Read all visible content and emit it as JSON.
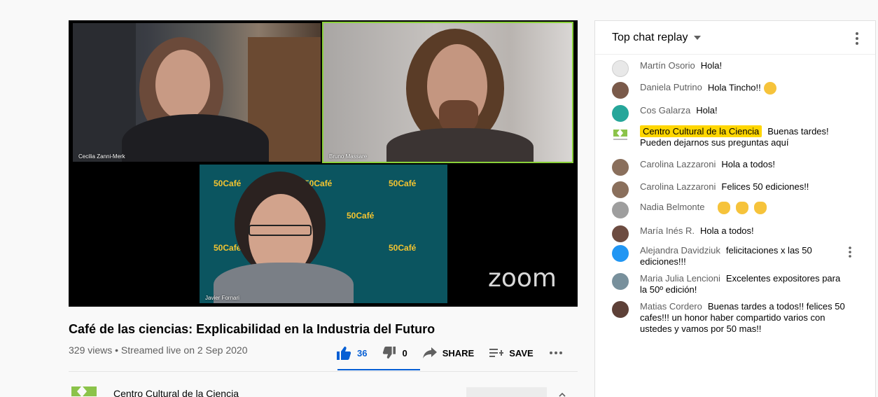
{
  "video": {
    "participants": [
      {
        "name": "Cecilia Zanni-Merk"
      },
      {
        "name": "Bruno Massare"
      },
      {
        "name": "Javier Fornari"
      }
    ],
    "brand_mark": "50Café",
    "zoom_logo": "zoom"
  },
  "video_info": {
    "title": "Café de las ciencias: Explicabilidad en la Industria del Futuro",
    "meta": "329 views • Streamed live on 2 Sep 2020"
  },
  "actions": {
    "like_count": "36",
    "dislike_count": "0",
    "share_label": "SHARE",
    "save_label": "SAVE"
  },
  "channel": {
    "name": "Centro Cultural de la Ciencia"
  },
  "chat": {
    "header": "Top chat replay",
    "messages": [
      {
        "author": "Martín Osorio",
        "text": "Hola!"
      },
      {
        "author": "Daniela Putrino",
        "text": "Hola Tincho!!"
      },
      {
        "author": "Cos Galarza",
        "text": "Hola!"
      },
      {
        "author": "Centro Cultural de la Ciencia",
        "text": "Buenas tardes! Pueden dejarnos sus preguntas aquí"
      },
      {
        "author": "Carolina Lazzaroni",
        "text": "Hola a todos!"
      },
      {
        "author": "Carolina Lazzaroni",
        "text": "Felices 50 ediciones!!"
      },
      {
        "author": "Nadia Belmonte",
        "text": ""
      },
      {
        "author": "María Inés R.",
        "text": "Hola a todos!"
      },
      {
        "author": "Alejandra Davidziuk",
        "text": "felicitaciones x las 50 ediciones!!!"
      },
      {
        "author": "Maria Julia Lencioni",
        "text": "Excelentes expositores para la 50º edición!"
      },
      {
        "author": "Matias Cordero",
        "text": "Buenas tardes a todos!! felices 50 cafes!!! un honor haber compartido varios con ustedes y vamos por 50 mas!!"
      }
    ]
  },
  "colors": {
    "accent_blue": "#065fd4",
    "owner_badge": "#ffd600",
    "active_speaker_border": "#8ad13a"
  }
}
